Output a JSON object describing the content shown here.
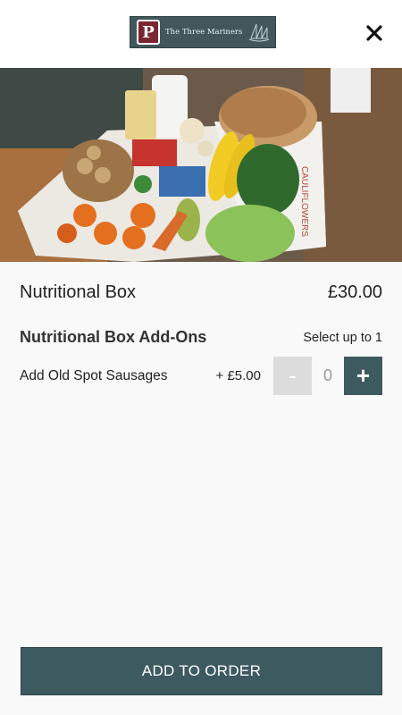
{
  "header": {
    "logo_text": "The Three Mariners",
    "logo_letter": "P"
  },
  "product": {
    "name": "Nutritional Box",
    "price": "£30.00",
    "image_box_text": "CAULIFLOWERS"
  },
  "addons": {
    "title": "Nutritional Box Add-Ons",
    "hint": "Select up to 1",
    "options": [
      {
        "name": "Add Old Spot Sausages",
        "price": "+ £5.00",
        "quantity": "0",
        "minus_label": "-",
        "plus_label": "+"
      }
    ]
  },
  "footer": {
    "add_label": "ADD TO ORDER"
  },
  "colors": {
    "accent": "#3d5a60",
    "disabled": "#dcdcdc",
    "logo_bg": "#41575c",
    "logo_badge": "#7a2630"
  },
  "icons": {
    "close": "close-icon",
    "logo_boats": "sailboats-icon"
  }
}
